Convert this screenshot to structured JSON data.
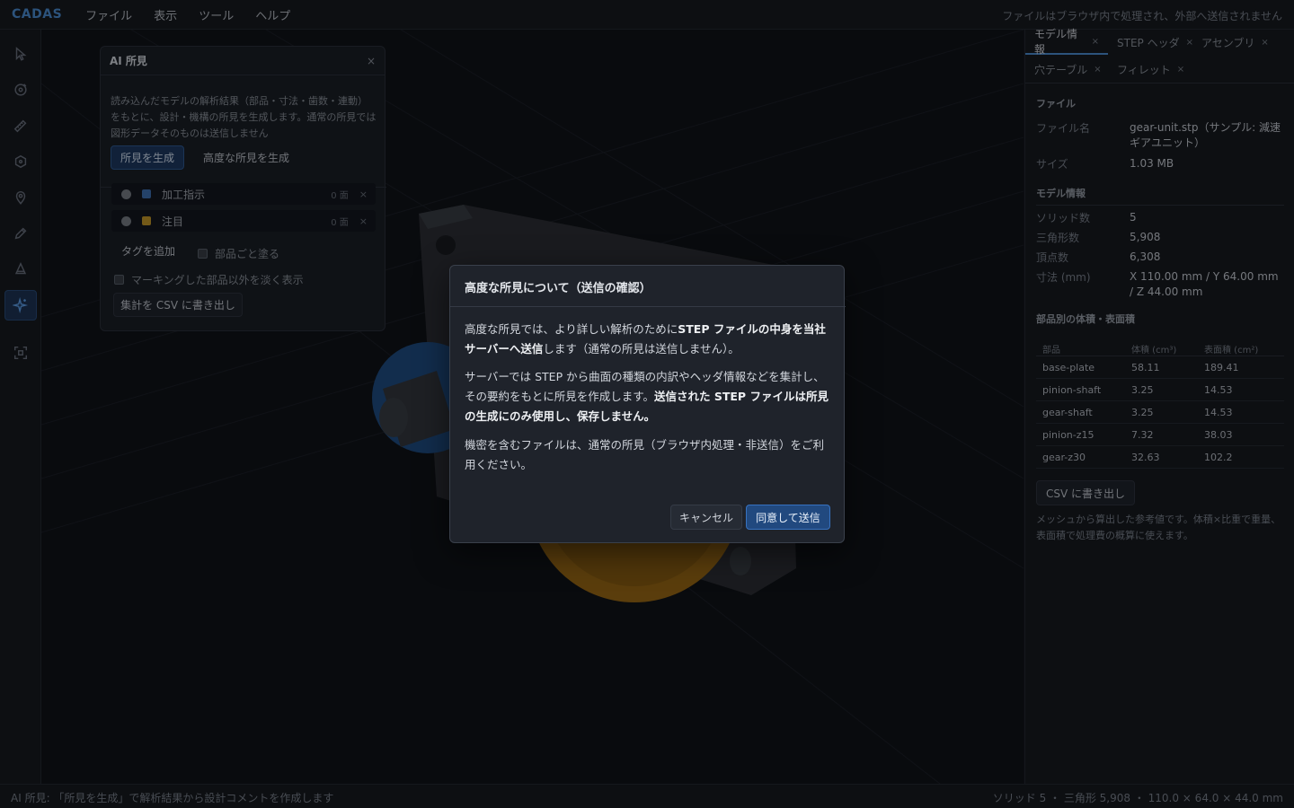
{
  "app": {
    "brand": "CADAS",
    "notice": "ファイルはブラウザ内で処理され、外部へ送信されません"
  },
  "menu": [
    "ファイル",
    "表示",
    "ツール",
    "ヘルプ"
  ],
  "toolbar": [
    "select-icon",
    "orbit-icon",
    "measure-icon",
    "part-icon",
    "pin-icon",
    "pencil-icon",
    "cone-icon",
    "sparkle-icon",
    "frame-icon"
  ],
  "ai_panel": {
    "title": "AI 所見",
    "close": "×",
    "description": "読み込んだモデルの解析結果（部品・寸法・歯数・連動）をもとに、設計・機構の所見を生成します。通常の所見では図形データそのものは送信しません",
    "generate_label": "所見を生成",
    "advanced_label": "高度な所見を生成",
    "tags": [
      {
        "name": "加工指示",
        "count": "0 面",
        "color": "#3f73b5",
        "remove": "×"
      },
      {
        "name": "注目",
        "count": "0 面",
        "color": "#c79a2a",
        "remove": "×"
      }
    ],
    "add_tag": "タグを追加",
    "paint_by_part": "部品ごと塗る",
    "fade_others": "マーキングした部品以外を淡く表示",
    "export_csv": "集計を CSV に書き出し"
  },
  "right_panel": {
    "tabs": [
      {
        "label": "モデル情報",
        "close": "×"
      },
      {
        "label": "STEP ヘッダ",
        "close": "×"
      },
      {
        "label": "アセンブリ",
        "close": "×"
      },
      {
        "label": "穴テーブル",
        "close": "×"
      },
      {
        "label": "フィレット",
        "close": "×"
      }
    ],
    "file_section": "ファイル",
    "file": [
      {
        "k": "ファイル名",
        "v": "gear-unit.stp（サンプル: 減速ギアユニット）"
      },
      {
        "k": "サイズ",
        "v": "1.03 MB"
      }
    ],
    "model_section": "モデル情報",
    "model": [
      {
        "k": "ソリッド数",
        "v": "5"
      },
      {
        "k": "三角形数",
        "v": "5,908"
      },
      {
        "k": "頂点数",
        "v": "6,308"
      },
      {
        "k": "寸法 (mm)",
        "v": "X 110.00 mm / Y 64.00 mm / Z 44.00 mm"
      }
    ],
    "volume_section": "部品別の体積・表面積",
    "table_headers": [
      "部品",
      "体積 (cm³)",
      "表面積 (cm²)"
    ],
    "table_rows": [
      [
        "base-plate",
        "58.11",
        "189.41"
      ],
      [
        "pinion-shaft",
        "3.25",
        "14.53"
      ],
      [
        "gear-shaft",
        "3.25",
        "14.53"
      ],
      [
        "pinion-z15",
        "7.32",
        "38.03"
      ],
      [
        "gear-z30",
        "32.63",
        "102.2"
      ]
    ],
    "csv_button": "CSV に書き出し",
    "note": "メッシュから算出した参考値です。体積×比重で重量、表面積で処理費の概算に使えます。"
  },
  "status": {
    "left": "AI 所見: 「所見を生成」で解析結果から設計コメントを作成します",
    "right": "ソリッド 5 ・ 三角形 5,908 ・ 110.0 × 64.0 × 44.0 mm"
  },
  "dialog": {
    "title": "高度な所見について（送信の確認）",
    "p1_a": "高度な所見では、より詳しい解析のために",
    "p1_b": "STEP ファイルの中身を当社サーバーへ送信",
    "p1_c": "します（通常の所見は送信しません）。",
    "p2_a": "サーバーでは STEP から曲面の種類の内訳やヘッダ情報などを集計し、その要約をもとに所見を作成します。",
    "p2_b": "送信された STEP ファイルは所見の生成にのみ使用し、保存しません。",
    "p3": "機密を含むファイルは、通常の所見（ブラウザ内処理・非送信）をご利用ください。",
    "cancel": "キャンセル",
    "confirm": "同意して送信"
  }
}
